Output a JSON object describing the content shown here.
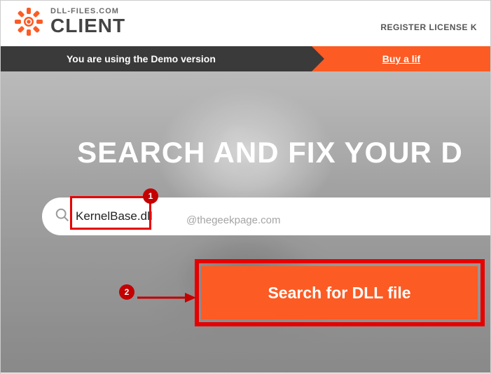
{
  "header": {
    "logo_top": "DLL-FILES.COM",
    "logo_bottom": "CLIENT",
    "register_link": "REGISTER LICENSE K"
  },
  "demo_bar": {
    "left_text": "You are using the Demo version",
    "right_text": "Buy a lif"
  },
  "hero": {
    "title": "SEARCH AND FIX YOUR D",
    "search_value": "KernelBase.dll",
    "search_button": "Search for DLL file"
  },
  "annotations": {
    "badge1": "1",
    "badge2": "2",
    "watermark": "@thegeekpage.com"
  }
}
